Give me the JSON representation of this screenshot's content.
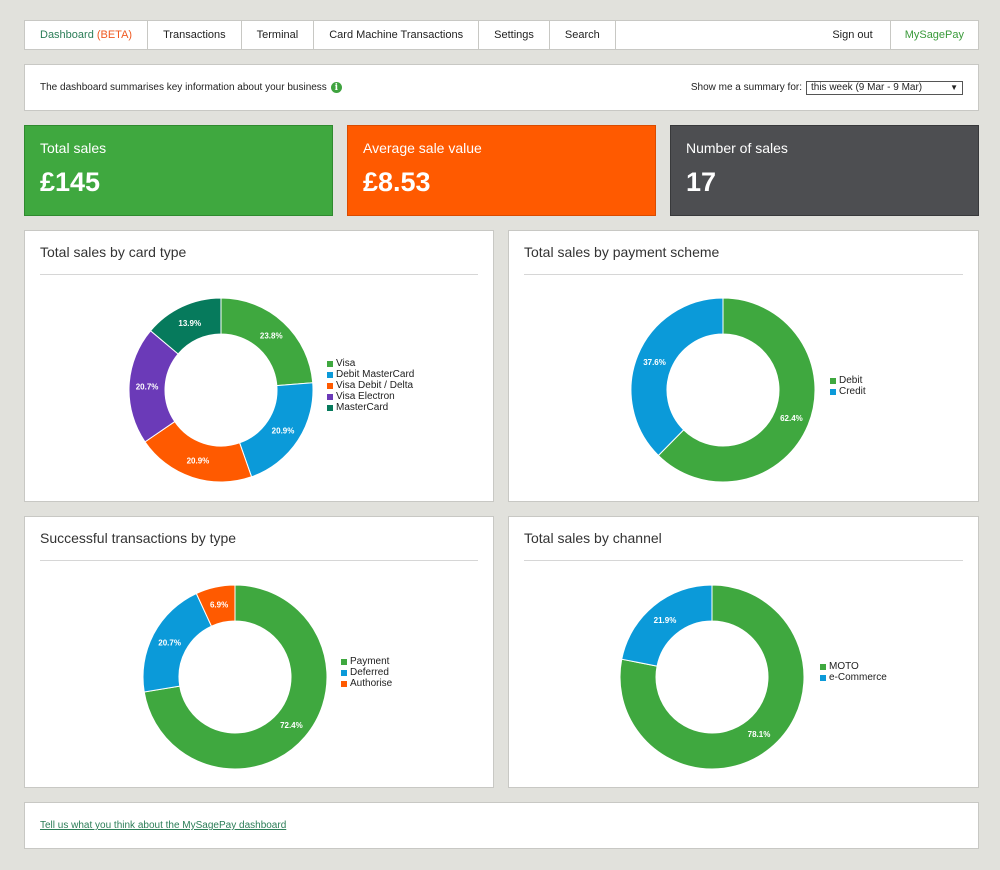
{
  "nav": {
    "items": [
      {
        "label": "Dashboard",
        "suffix": "(BETA)"
      },
      {
        "label": "Transactions"
      },
      {
        "label": "Terminal"
      },
      {
        "label": "Card Machine Transactions"
      },
      {
        "label": "Settings"
      },
      {
        "label": "Search"
      }
    ],
    "sign_out": "Sign out",
    "brand": "MySagePay"
  },
  "info": {
    "text": "The dashboard summarises key information about your business",
    "summary_label": "Show me a summary for:",
    "period_value": "this week (9 Mar - 9 Mar)"
  },
  "stats": {
    "total_sales": {
      "label": "Total sales",
      "value": "£145",
      "color": "#3fa83f"
    },
    "average_sale": {
      "label": "Average sale value",
      "value": "£8.53",
      "color": "#ff5a00"
    },
    "number_of_sales": {
      "label": "Number of sales",
      "value": "17",
      "color": "#4d4e51"
    }
  },
  "colors": {
    "green": "#3fa83f",
    "blue": "#0b9ad9",
    "orange": "#ff5a00",
    "purple": "#6b3ab8",
    "teal": "#067a5c"
  },
  "chart_data": [
    {
      "type": "pie",
      "title": "Total sales by card type",
      "series": [
        {
          "name": "Visa",
          "value": 23.8,
          "label": "23.8%",
          "color": "#3fa83f"
        },
        {
          "name": "Debit MasterCard",
          "value": 20.9,
          "label": "20.9%",
          "color": "#0b9ad9"
        },
        {
          "name": "Visa Debit / Delta",
          "value": 20.9,
          "label": "20.9%",
          "color": "#ff5a00"
        },
        {
          "name": "Visa Electron",
          "value": 20.7,
          "label": "20.7%",
          "color": "#6b3ab8"
        },
        {
          "name": "MasterCard",
          "value": 13.9,
          "label": "13.9%",
          "color": "#067a5c"
        }
      ],
      "legend": "right"
    },
    {
      "type": "pie",
      "title": "Total sales by payment scheme",
      "series": [
        {
          "name": "Debit",
          "value": 62.4,
          "label": "62.4%",
          "color": "#3fa83f"
        },
        {
          "name": "Credit",
          "value": 37.6,
          "label": "37.6%",
          "color": "#0b9ad9"
        }
      ],
      "legend": "right"
    },
    {
      "type": "pie",
      "title": "Successful transactions by type",
      "series": [
        {
          "name": "Payment",
          "value": 72.4,
          "label": "72.4%",
          "color": "#3fa83f"
        },
        {
          "name": "Deferred",
          "value": 20.7,
          "label": "20.7%",
          "color": "#0b9ad9"
        },
        {
          "name": "Authorise",
          "value": 6.9,
          "label": "6.9%",
          "color": "#ff5a00"
        }
      ],
      "legend": "right"
    },
    {
      "type": "pie",
      "title": "Total sales by channel",
      "series": [
        {
          "name": "MOTO",
          "value": 78.1,
          "label": "78.1%",
          "color": "#3fa83f"
        },
        {
          "name": "e-Commerce",
          "value": 21.9,
          "label": "21.9%",
          "color": "#0b9ad9"
        }
      ],
      "legend": "right"
    }
  ],
  "footer": {
    "feedback_link": "Tell us what you think about the MySagePay dashboard"
  }
}
